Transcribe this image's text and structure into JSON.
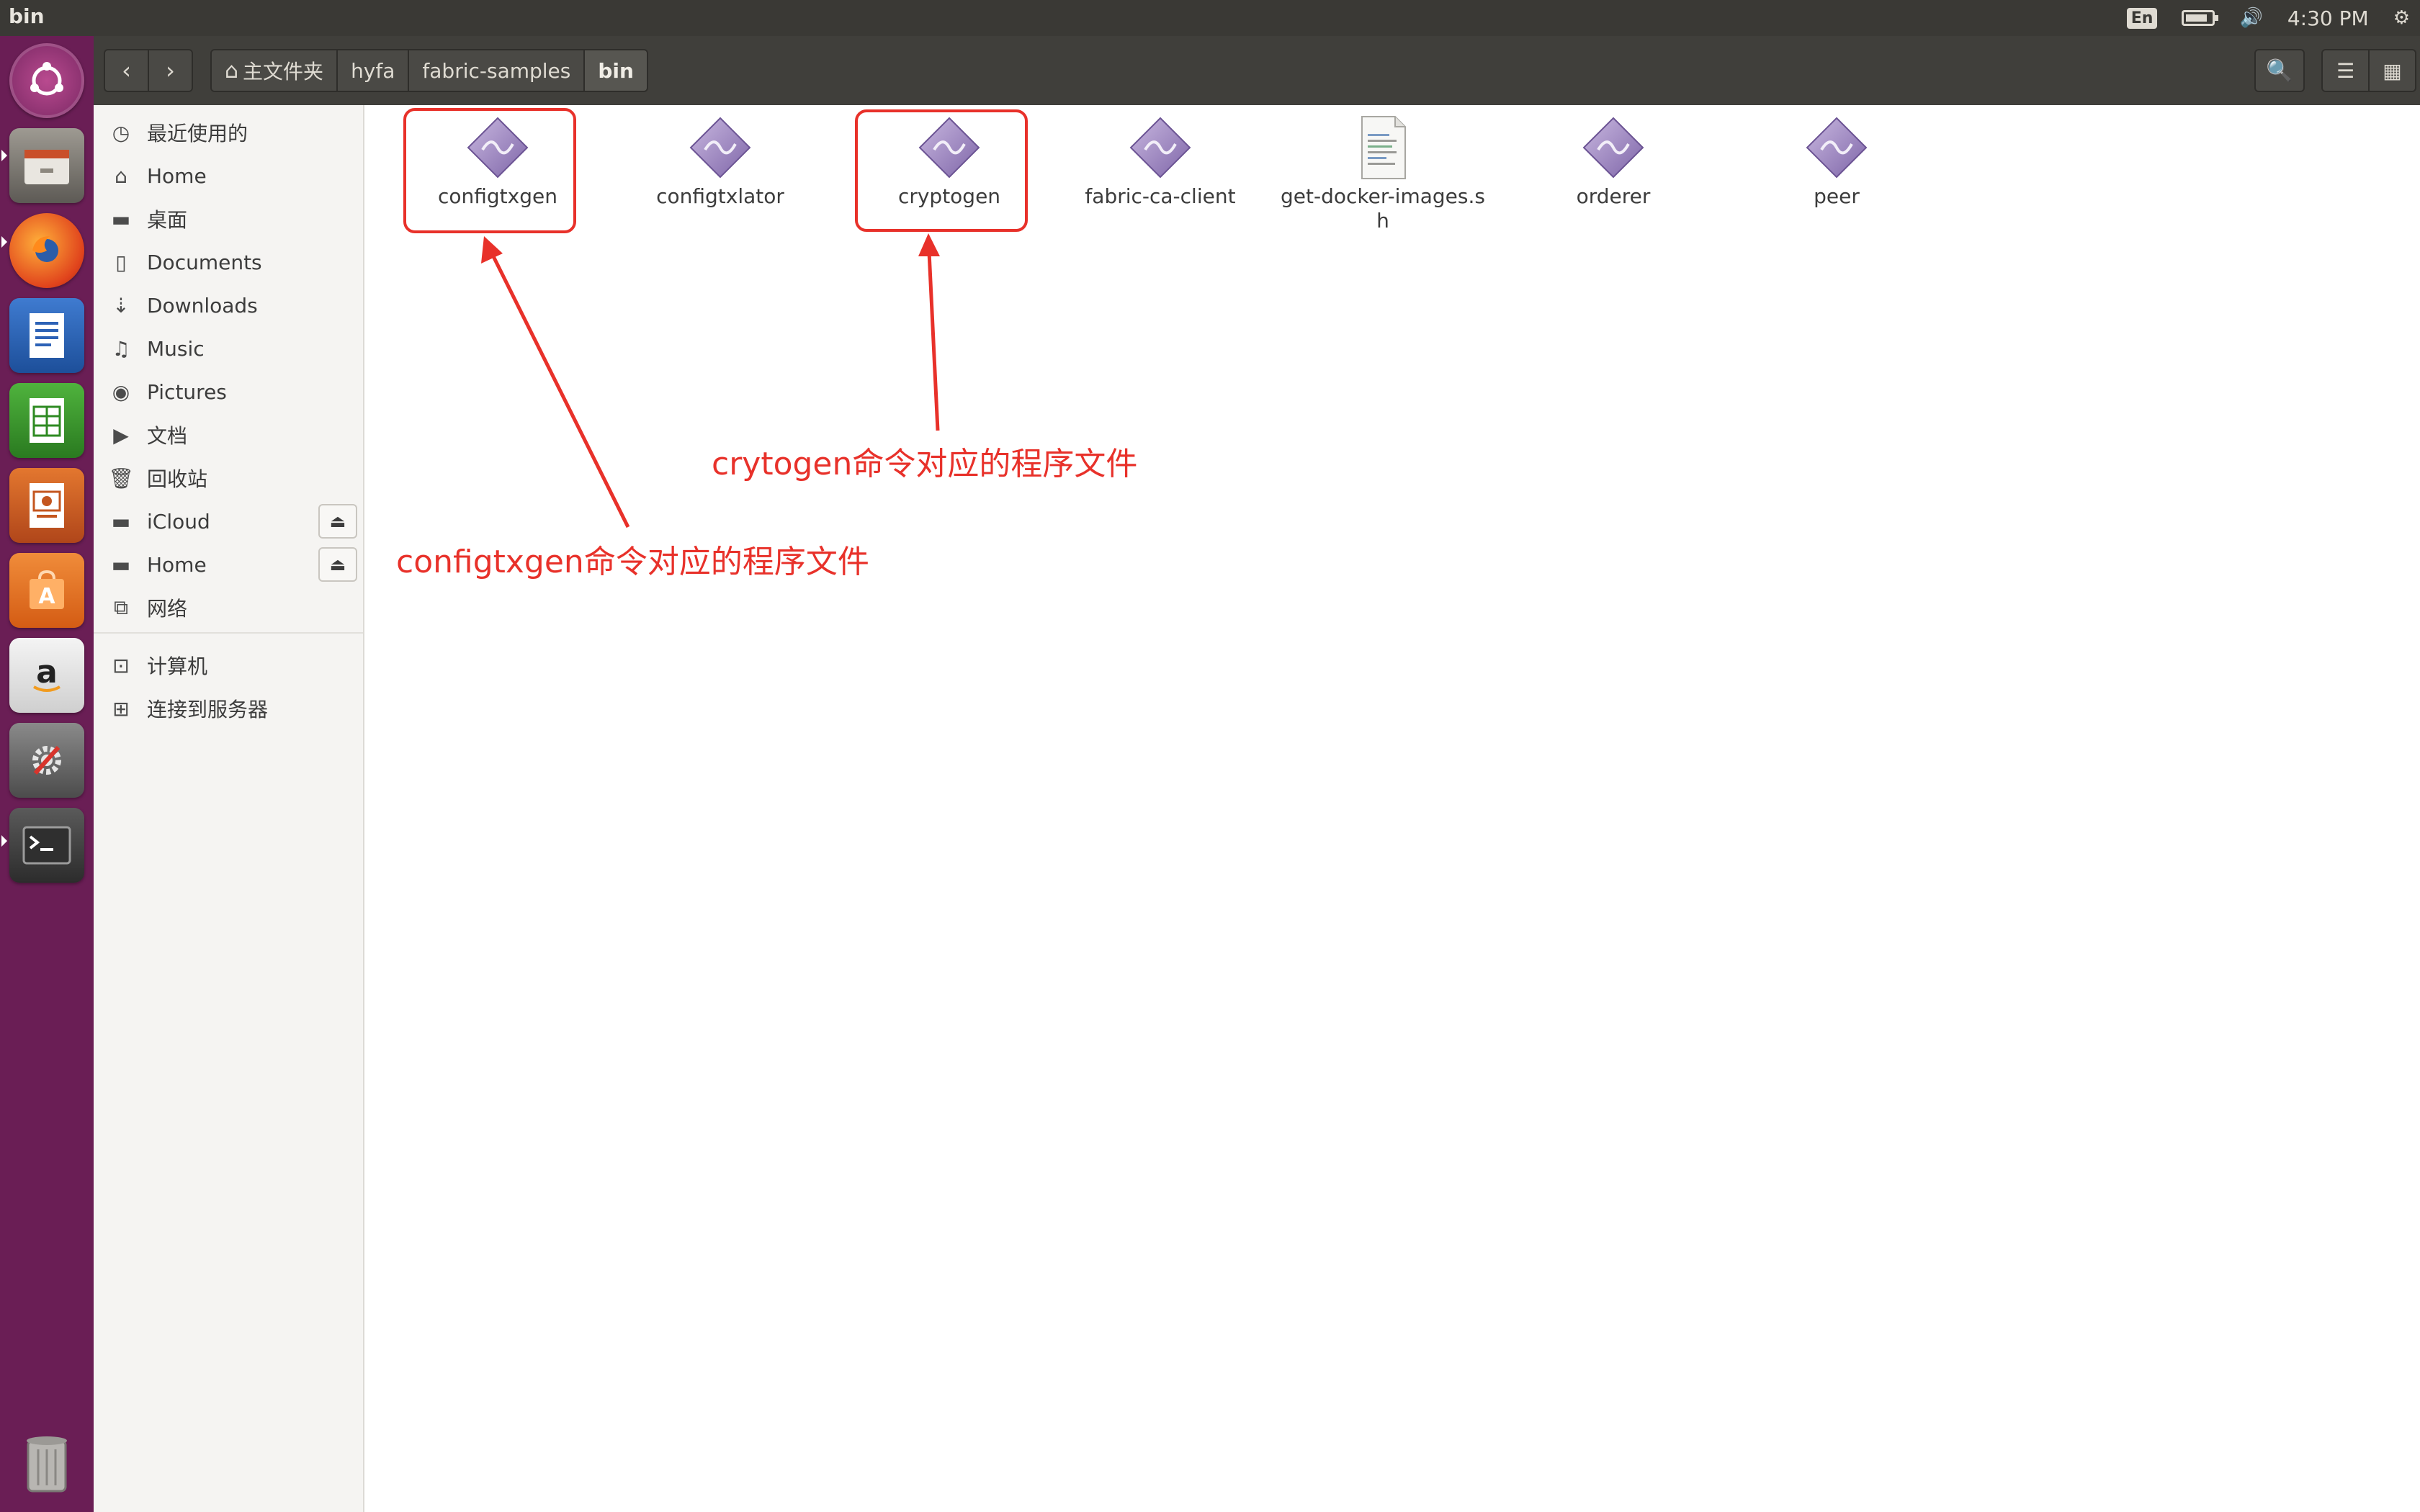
{
  "panel": {
    "window_title": "bin",
    "lang": "En",
    "battery_level": 0.85,
    "clock": "4:30 PM"
  },
  "header": {
    "breadcrumb": [
      "主文件夹",
      "hyfa",
      "fabric-samples",
      "bin"
    ]
  },
  "sidebar": {
    "items": [
      {
        "label": "最近使用的",
        "icon": "clock-icon"
      },
      {
        "label": "Home",
        "icon": "home-icon"
      },
      {
        "label": "桌面",
        "icon": "folder-icon"
      },
      {
        "label": "Documents",
        "icon": "document-icon"
      },
      {
        "label": "Downloads",
        "icon": "download-icon"
      },
      {
        "label": "Music",
        "icon": "music-icon"
      },
      {
        "label": "Pictures",
        "icon": "camera-icon"
      },
      {
        "label": "文档",
        "icon": "video-icon"
      },
      {
        "label": "回收站",
        "icon": "trash-icon"
      },
      {
        "label": "iCloud",
        "icon": "drive-icon"
      },
      {
        "label": "Home",
        "icon": "drive-icon"
      },
      {
        "label": "网络",
        "icon": "network-icon"
      },
      {
        "label": "计算机",
        "icon": "computer-icon"
      },
      {
        "label": "连接到服务器",
        "icon": "server-icon"
      }
    ]
  },
  "files": [
    {
      "name": "configtxgen",
      "type": "executable"
    },
    {
      "name": "configtxlator",
      "type": "executable"
    },
    {
      "name": "cryptogen",
      "type": "executable"
    },
    {
      "name": "fabric-ca-client",
      "type": "executable"
    },
    {
      "name": "get-docker-images.sh",
      "type": "script"
    },
    {
      "name": "orderer",
      "type": "executable"
    },
    {
      "name": "peer",
      "type": "executable"
    }
  ],
  "annotations": {
    "configtxgen_note": "configtxgen命令对应的程序文件",
    "cryptogen_note": "crytogen命令对应的程序文件",
    "color": "#e8312a"
  },
  "colors": {
    "launcher": "#6a1e55",
    "top_panel": "#3a3935",
    "header_bar": "#403f3b"
  }
}
